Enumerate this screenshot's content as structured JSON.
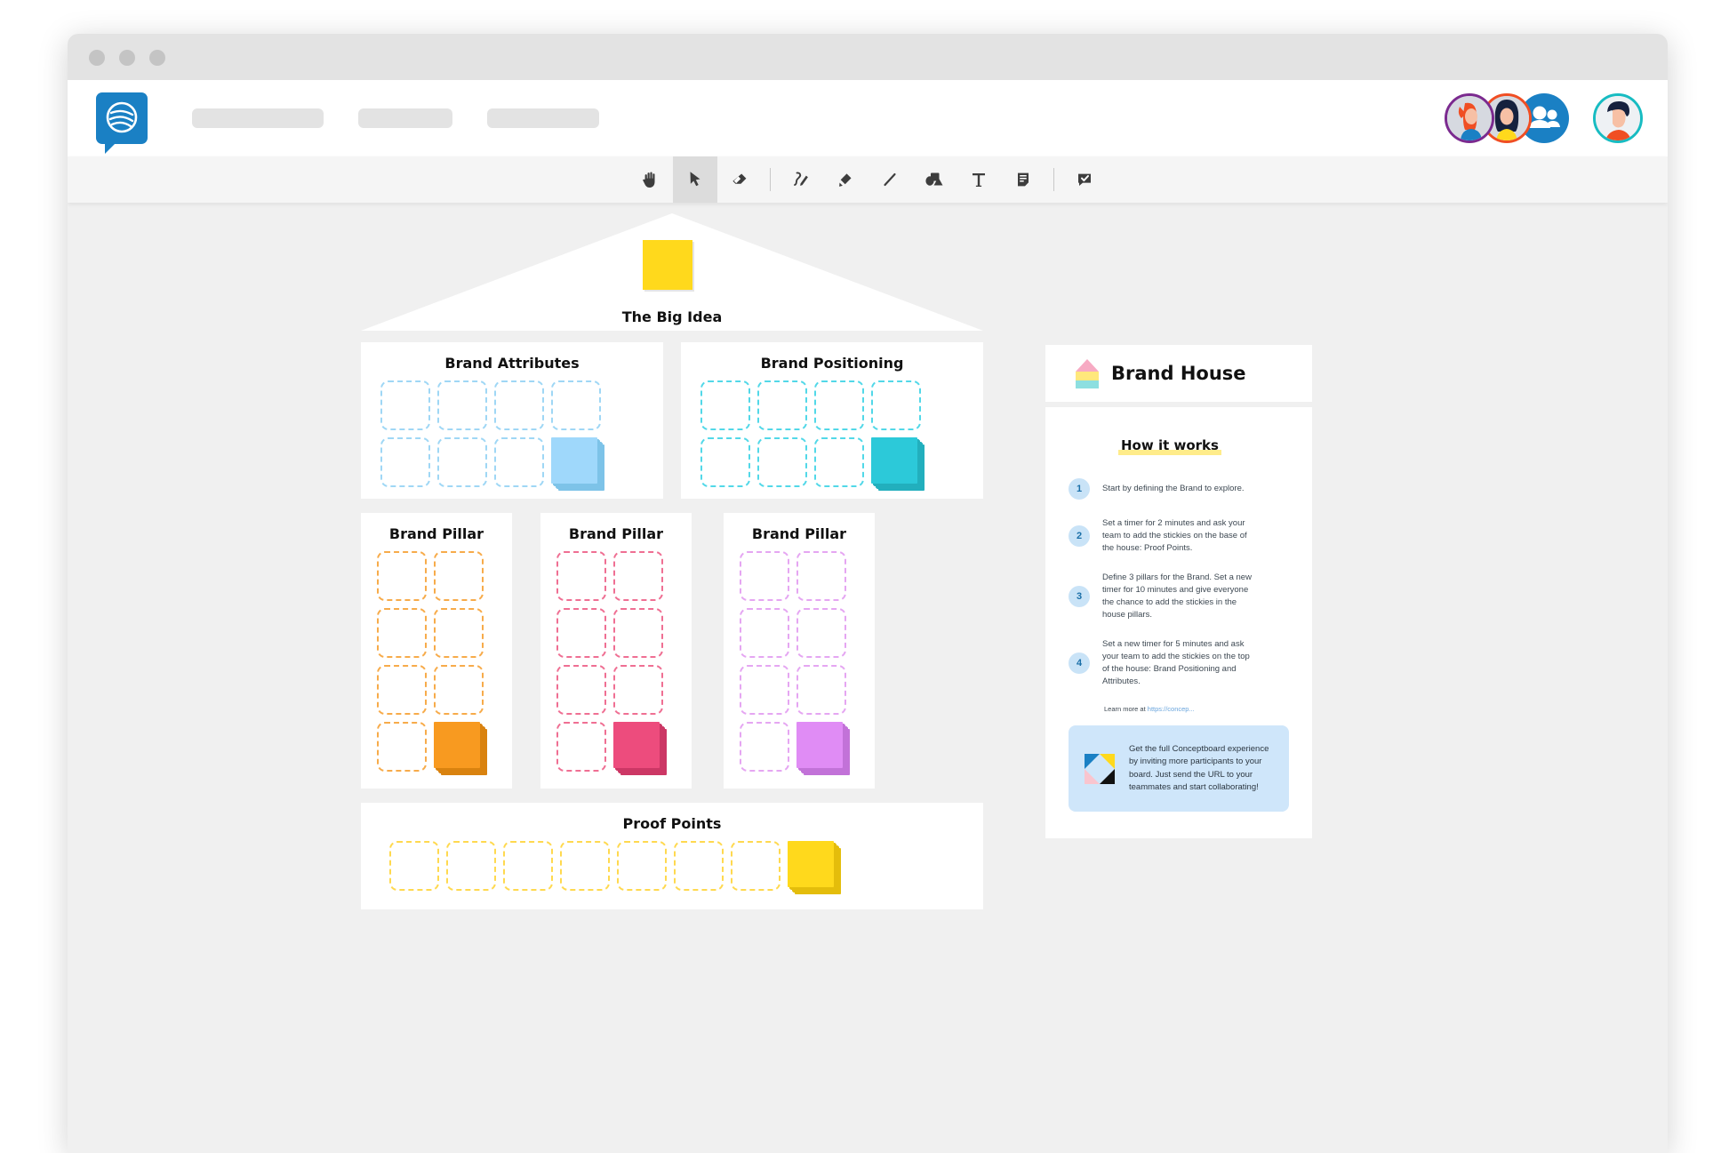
{
  "window": {
    "dots": [
      "close",
      "minimize",
      "maximize"
    ]
  },
  "header": {
    "logo_name": "conceptboard-logo",
    "nav_placeholders": [
      "",
      "",
      ""
    ],
    "avatars": [
      {
        "name": "avatar-user-1",
        "ring": "#7b2a8f"
      },
      {
        "name": "avatar-user-2",
        "ring": "#f04e23"
      },
      {
        "name": "avatar-group",
        "ring": "#1a80c4"
      },
      {
        "name": "avatar-current-user",
        "ring": "#17bcc2"
      }
    ]
  },
  "toolbar": {
    "tools": [
      {
        "name": "pan-hand-icon",
        "label": "Pan",
        "active": false
      },
      {
        "name": "select-cursor-icon",
        "label": "Select",
        "active": true
      },
      {
        "name": "eraser-icon",
        "label": "Eraser",
        "active": false
      },
      {
        "name": "pen-icon",
        "label": "Pen",
        "active": false
      },
      {
        "name": "highlighter-icon",
        "label": "Highlighter",
        "active": false
      },
      {
        "name": "line-icon",
        "label": "Line",
        "active": false
      },
      {
        "name": "shapes-icon",
        "label": "Shapes",
        "active": false
      },
      {
        "name": "text-icon",
        "label": "Text",
        "active": false
      },
      {
        "name": "sticky-note-icon",
        "label": "Sticky note",
        "active": false
      },
      {
        "name": "comment-icon",
        "label": "Comment",
        "active": false
      }
    ]
  },
  "board": {
    "roof": {
      "label": "The Big Idea",
      "note_color": "#ffd91c"
    },
    "top_sections": [
      {
        "title": "Brand Attributes",
        "slot_color": "#9fd7f5",
        "slots": 7,
        "note_color": "#9fd8fb",
        "note_shadow": "#7dc3e8"
      },
      {
        "title": "Brand Positioning",
        "slot_color": "#52d8e8",
        "slots": 7,
        "note_color": "#2cc9d9",
        "note_shadow": "#22afbd"
      }
    ],
    "pillars": [
      {
        "title": "Brand Pillar",
        "slot_color": "#f7ab4a",
        "slots": 7,
        "note_color": "#f89a20",
        "note_shadow": "#d9820f"
      },
      {
        "title": "Brand Pillar",
        "slot_color": "#ef6f93",
        "slots": 7,
        "note_color": "#ed4c7d",
        "note_shadow": "#cc3765"
      },
      {
        "title": "Brand Pillar",
        "slot_color": "#e5a6f2",
        "slots": 7,
        "note_color": "#e08cf5",
        "note_shadow": "#c272d8"
      }
    ],
    "base": {
      "title": "Proof Points",
      "slot_color": "#ffd94f",
      "slots": 7,
      "note_color": "#ffd91c",
      "note_shadow": "#e4bd0b"
    }
  },
  "info_card": {
    "title": "Brand House",
    "icon_name": "brand-house-icon",
    "how_it_works": "How it works",
    "steps": [
      {
        "number": "1",
        "text": "Start by defining the Brand to explore."
      },
      {
        "number": "2",
        "text": "Set a timer for 2 minutes and ask your team to add the stickies on the base of the house: Proof Points."
      },
      {
        "number": "3",
        "text": "Define 3 pillars for the Brand. Set a new timer for 10 minutes and give everyone the chance to add the stickies in the house pillars."
      },
      {
        "number": "4",
        "text": "Set a new timer for 5 minutes and ask your team to add the stickies on the top of the house: Brand Positioning and Attributes."
      }
    ],
    "learn_more_prefix": "Learn more at ",
    "learn_more_link": "https://concep...",
    "promo": {
      "icon_name": "conceptboard-mark-icon",
      "text": "Get the full Conceptboard experience by inviting more participants to your board. Just send the URL to your teammates and start collaborating!"
    }
  },
  "colors": {
    "accent": "#1a80c4",
    "canvas_bg": "#f0f0f0",
    "panel_bg": "#ffffff",
    "promo_bg": "#cfe6fa",
    "highlight": "#ffec8a"
  }
}
